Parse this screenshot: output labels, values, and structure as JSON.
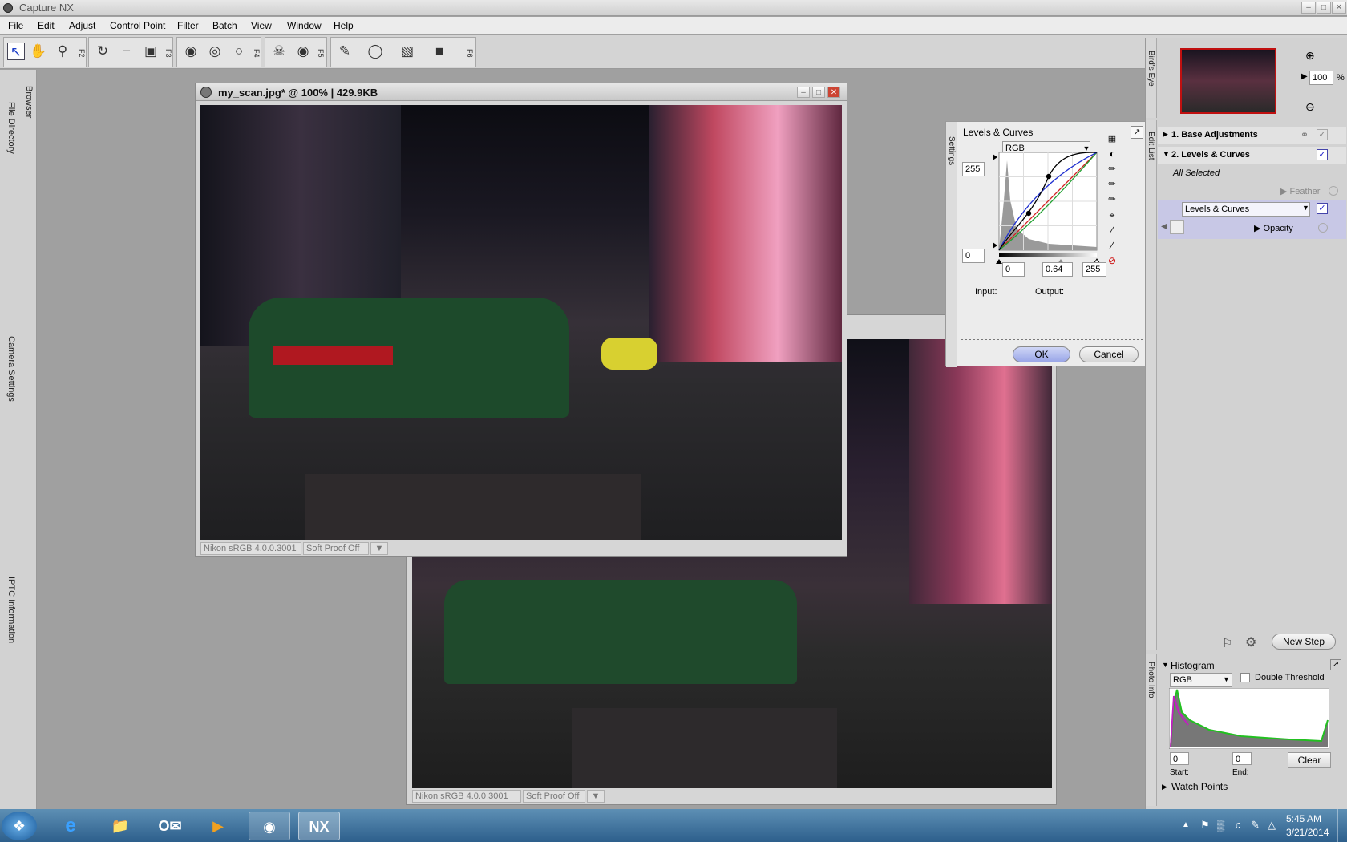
{
  "app": {
    "title": "Capture NX"
  },
  "menu": [
    "File",
    "Edit",
    "Adjust",
    "Control Point",
    "Filter",
    "Batch",
    "View",
    "Window",
    "Help"
  ],
  "toolbar": {
    "groups": [
      {
        "icons": [
          "direct-select-arrow-icon",
          "hand-icon",
          "zoom-icon"
        ],
        "key": "F2"
      },
      {
        "icons": [
          "rotate-icon",
          "straighten-icon",
          "crop-icon"
        ],
        "key": "F3"
      },
      {
        "icons": [
          "black-control-point-icon",
          "neutral-control-point-icon",
          "white-control-point-icon"
        ],
        "key": "F4"
      },
      {
        "icons": [
          "red-eye-control-point-icon",
          "red-eye-icon"
        ],
        "key": "F5"
      },
      {
        "icons": [
          "brush-icon",
          "lasso-icon",
          "gradient-icon",
          "fill-icon"
        ],
        "key": "F6"
      }
    ]
  },
  "left_tabs": {
    "browser": "Browser",
    "file_directory": "File Directory",
    "camera_settings": "Camera Settings",
    "iptc": "IPTC Information"
  },
  "image_window_front": {
    "title": "my_scan.jpg* @ 100% | 429.9KB",
    "profile": "Nikon sRGB 4.0.0.3001",
    "proof": "Soft Proof Off"
  },
  "image_window_back": {
    "profile": "Nikon sRGB 4.0.0.3001",
    "proof": "Soft Proof Off"
  },
  "levels_curves": {
    "title": "Levels & Curves",
    "side_tab": "Settings",
    "channel": "RGB",
    "top_value": "255",
    "bottom_value": "0",
    "black_point": "0",
    "gamma": "0.64",
    "white_point": "255",
    "input_label": "Input:",
    "output_label": "Output:",
    "ok": "OK",
    "cancel": "Cancel",
    "curve_colors": {
      "rgb": "#000000",
      "red": "#d02020",
      "green": "#20a030",
      "blue": "#2030d0"
    }
  },
  "birds_eye": {
    "tab": "Bird's Eye",
    "zoom_value": "100",
    "zoom_unit": "%"
  },
  "edit_list": {
    "tab": "Edit List",
    "steps": [
      {
        "label": "1. Base Adjustments"
      },
      {
        "label": "2. Levels & Curves"
      }
    ],
    "all_selected": "All Selected",
    "feather": "Feather",
    "step_select": "Levels & Curves",
    "opacity": "Opacity",
    "new_step": "New Step"
  },
  "histogram": {
    "tab": "Photo Info",
    "title": "Histogram",
    "channel": "RGB",
    "double_threshold": "Double Threshold",
    "start_value": "0",
    "end_value": "0",
    "start_label": "Start:",
    "end_label": "End:",
    "clear": "Clear",
    "watch_points": "Watch Points"
  },
  "taskbar": {
    "apps": [
      "start-orb-icon",
      "internet-explorer-icon",
      "file-explorer-icon",
      "outlook-icon",
      "media-player-icon",
      "chrome-icon",
      "capture-nx-icon"
    ],
    "time": "5:45 AM",
    "date": "3/21/2014"
  }
}
